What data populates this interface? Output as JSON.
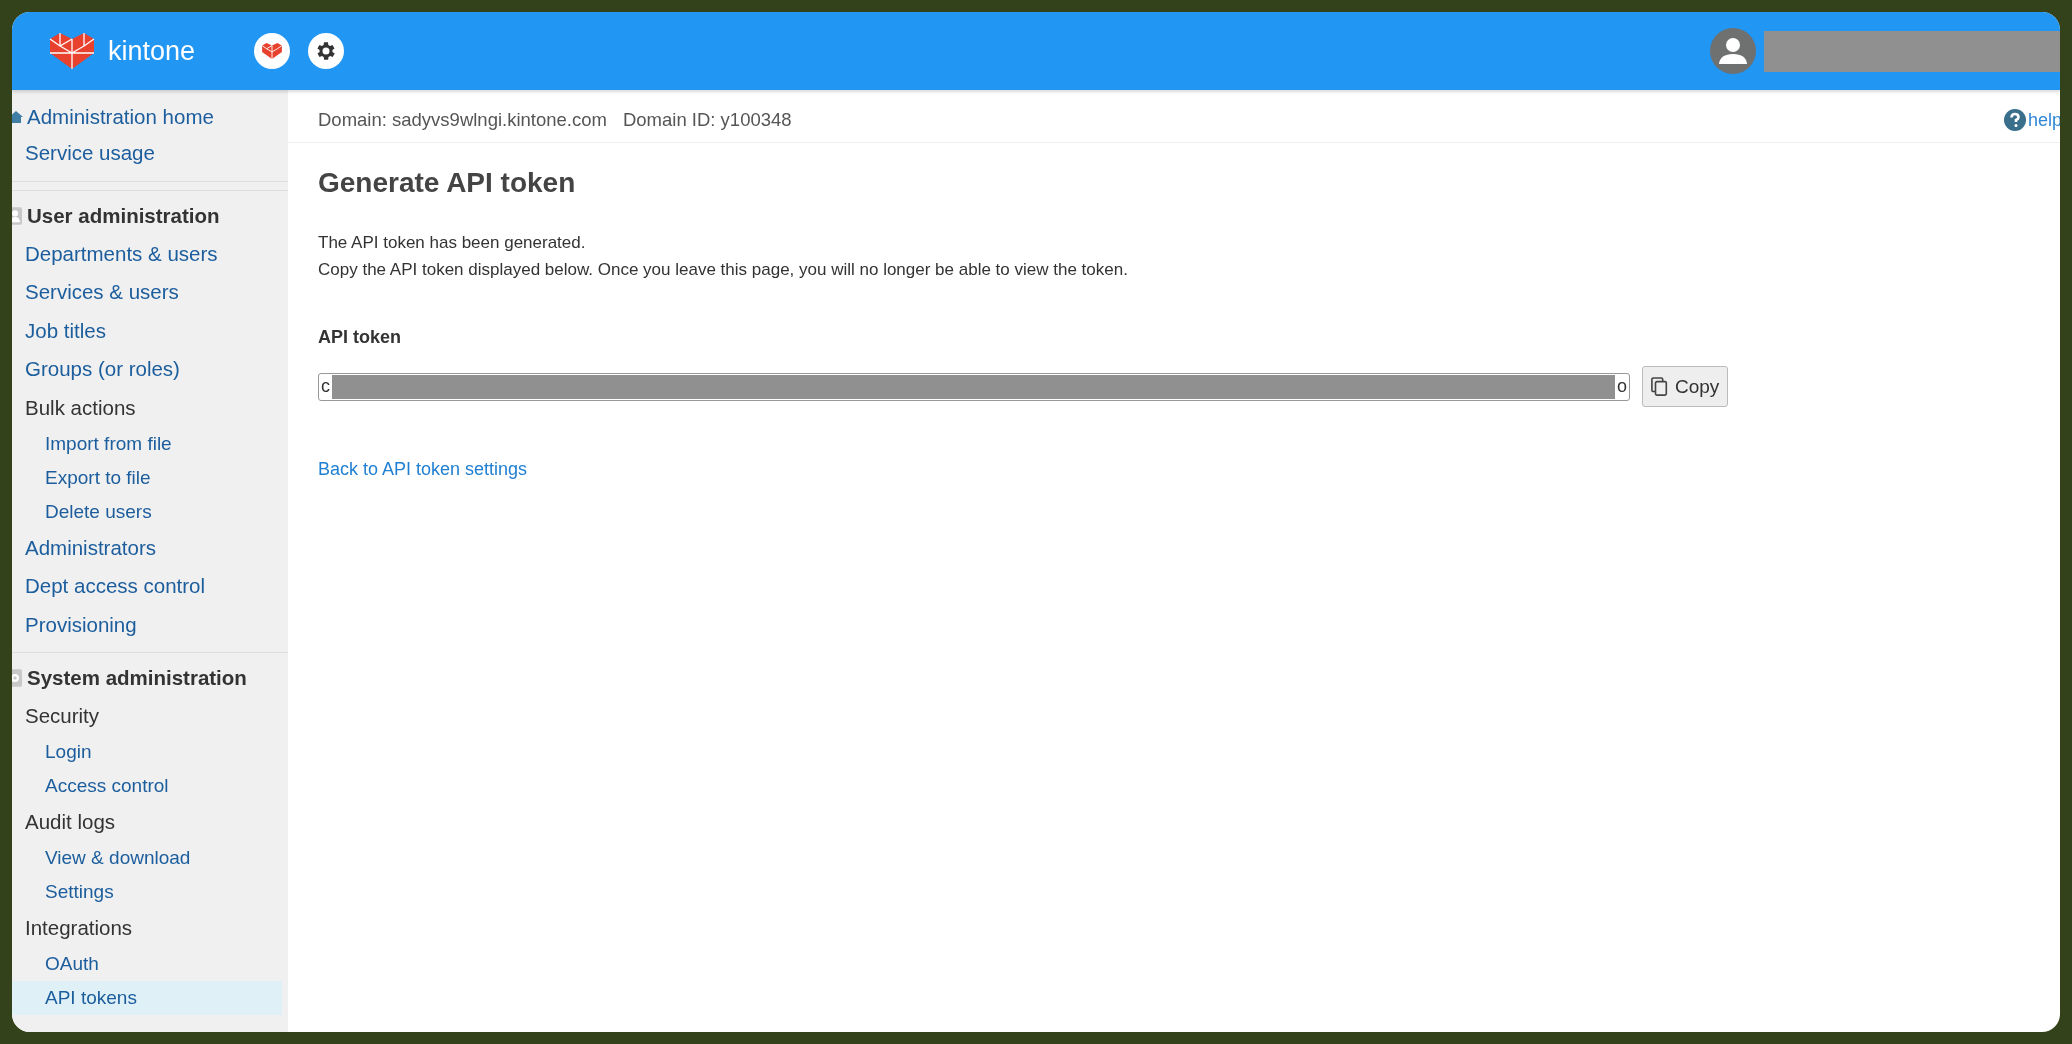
{
  "header": {
    "brand": "kintone"
  },
  "sidebar": {
    "items": [
      {
        "kind": "home",
        "label": "Administration home",
        "selected": false
      },
      {
        "kind": "link",
        "label": "Service usage",
        "selected": false
      },
      {
        "kind": "section",
        "label": "User administration"
      },
      {
        "kind": "link",
        "label": "Departments & users",
        "selected": false
      },
      {
        "kind": "link",
        "label": "Services & users",
        "selected": false
      },
      {
        "kind": "link",
        "label": "Job titles",
        "selected": false
      },
      {
        "kind": "link",
        "label": "Groups (or roles)",
        "selected": false
      },
      {
        "kind": "group",
        "label": "Bulk actions"
      },
      {
        "kind": "sublink",
        "label": "Import from file",
        "selected": false
      },
      {
        "kind": "sublink",
        "label": "Export to file",
        "selected": false
      },
      {
        "kind": "sublink",
        "label": "Delete users",
        "selected": false
      },
      {
        "kind": "link",
        "label": "Administrators",
        "selected": false
      },
      {
        "kind": "link",
        "label": "Dept access control",
        "selected": false
      },
      {
        "kind": "link",
        "label": "Provisioning",
        "selected": false
      },
      {
        "kind": "section",
        "label": "System administration"
      },
      {
        "kind": "group",
        "label": "Security"
      },
      {
        "kind": "sublink",
        "label": "Login",
        "selected": false
      },
      {
        "kind": "sublink",
        "label": "Access control",
        "selected": false
      },
      {
        "kind": "group",
        "label": "Audit logs"
      },
      {
        "kind": "sublink",
        "label": "View & download",
        "selected": false
      },
      {
        "kind": "sublink",
        "label": "Settings",
        "selected": false
      },
      {
        "kind": "group",
        "label": "Integrations"
      },
      {
        "kind": "sublink",
        "label": "OAuth",
        "selected": false
      },
      {
        "kind": "sublink",
        "label": "API tokens",
        "selected": true
      }
    ]
  },
  "domain_bar": {
    "domain": "Domain: sadyvs9wlngi.kintone.com",
    "domain_id": "Domain ID: y100348",
    "help": "help"
  },
  "content": {
    "title": "Generate API token",
    "message": [
      "The API token has been generated.",
      "Copy the API token displayed below. Once you leave this page, you will no longer be able to view the token."
    ],
    "token_label": "API token",
    "token_field": {
      "visible_start": "c",
      "visible_end": "o"
    },
    "copy_button": "Copy",
    "back_link": "Back to API token settings"
  }
}
